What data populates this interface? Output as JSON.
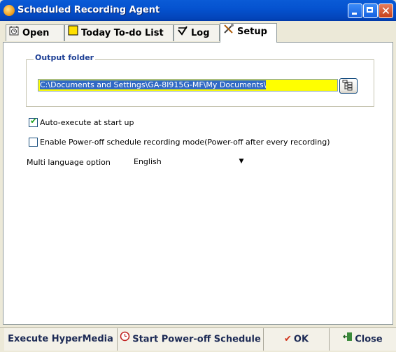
{
  "window": {
    "title": "Scheduled Recording Agent"
  },
  "tabs": [
    {
      "label": "Open",
      "icon": "open-clock-icon"
    },
    {
      "label": "Today To-do List",
      "icon": "yellow-note-icon"
    },
    {
      "label": "Log",
      "icon": "log-check-icon"
    },
    {
      "label": "Setup",
      "icon": "tools-icon",
      "active": true
    }
  ],
  "setup": {
    "output_group_title": "Output folder",
    "output_path": "C:\\Documents and Settings\\GA-8I915G-MF\\My Documents\\",
    "auto_execute_label": "Auto-execute at start up",
    "auto_execute_checked": true,
    "poweroff_mode_label": "Enable Power-off schedule recording mode(Power-off after every recording)",
    "poweroff_mode_checked": false,
    "language_label": "Multi language option",
    "language_value": "English"
  },
  "bottom": {
    "execute_label": "Execute HyperMedia",
    "start_poweroff_label": "Start Power-off Schedule",
    "ok_label": "OK",
    "close_label": "Close"
  },
  "colors": {
    "title_bar": "#0553d0",
    "path_field": "#ffff00",
    "path_selection": "#316ac5"
  }
}
